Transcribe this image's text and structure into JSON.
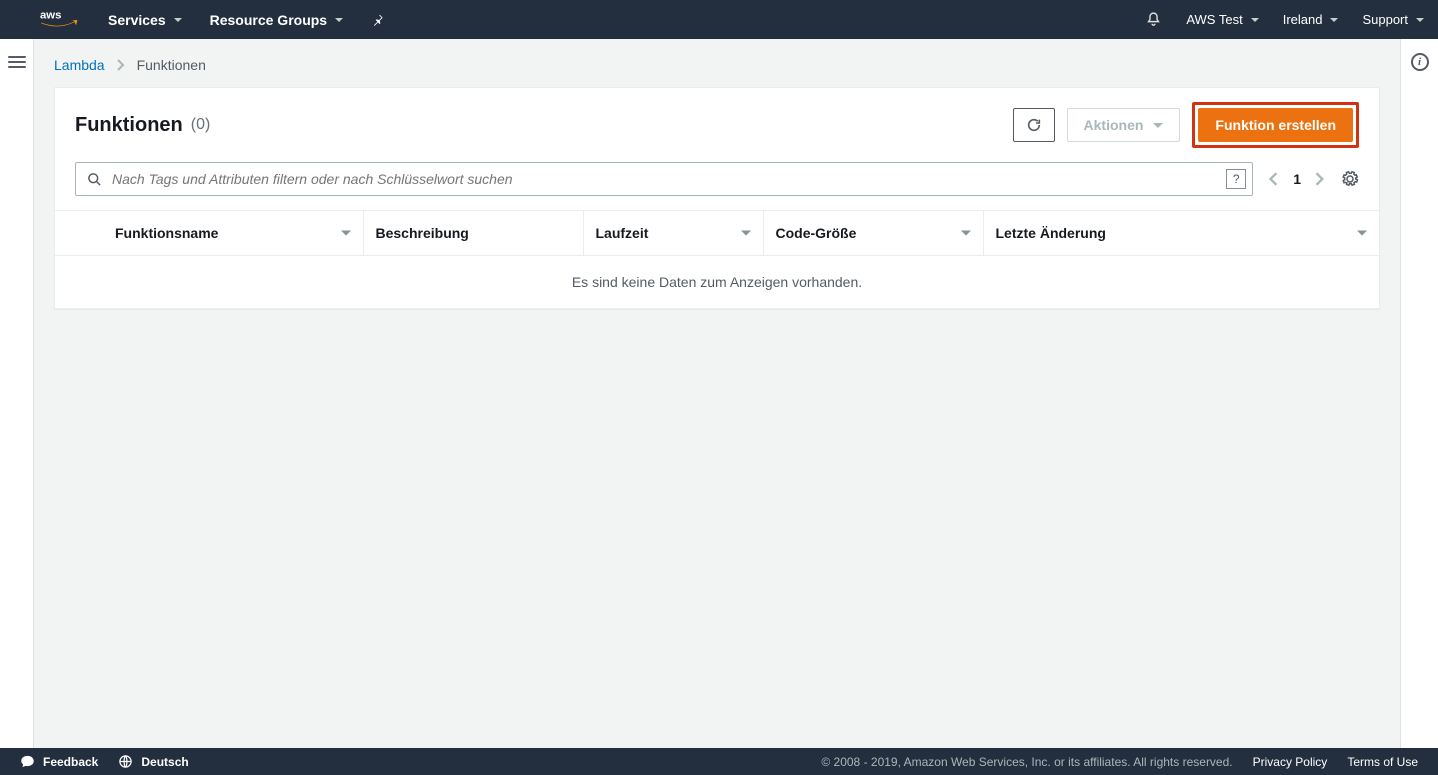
{
  "topbar": {
    "services": "Services",
    "resource_groups": "Resource Groups",
    "account": "AWS Test",
    "region": "Ireland",
    "support": "Support"
  },
  "breadcrumb": {
    "root": "Lambda",
    "current": "Funktionen"
  },
  "panel": {
    "title": "Funktionen",
    "count": "(0)",
    "actions_label": "Aktionen",
    "create_label": "Funktion erstellen"
  },
  "search": {
    "placeholder": "Nach Tags und Attributen filtern oder nach Schlüsselwort suchen"
  },
  "pager": {
    "current": "1"
  },
  "columns": {
    "name": "Funktionsname",
    "description": "Beschreibung",
    "runtime": "Laufzeit",
    "codesize": "Code-Größe",
    "lastmod": "Letzte Änderung"
  },
  "table": {
    "empty": "Es sind keine Daten zum Anzeigen vorhanden."
  },
  "footer": {
    "feedback": "Feedback",
    "language": "Deutsch",
    "copyright": "© 2008 - 2019, Amazon Web Services, Inc. or its affiliates. All rights reserved.",
    "privacy": "Privacy Policy",
    "terms": "Terms of Use"
  }
}
